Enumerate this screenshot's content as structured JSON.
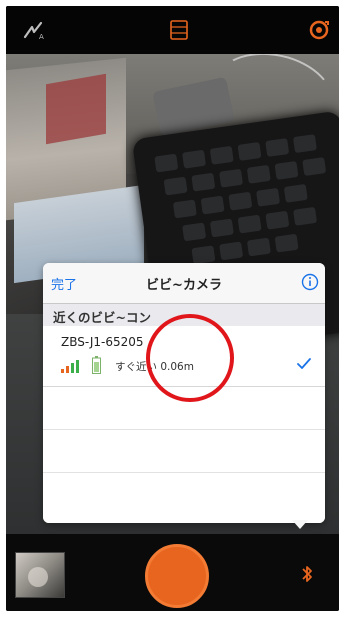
{
  "colors": {
    "accent_orange": "#e8651f",
    "link_blue": "#1a73e8",
    "annotation_red": "#e0161b"
  },
  "topbar": {
    "flash_icon": "flash-auto-icon",
    "grid_icon": "grid-icon",
    "switch_icon": "camera-switch-icon"
  },
  "popover": {
    "done_label": "完了",
    "title": "ビビ~カメラ",
    "info_icon": "info-icon",
    "section_header": "近くのビビ~コン",
    "device": {
      "name": "ZBS-J1-65205",
      "distance_text": "すぐ近い 0.06m",
      "selected": true
    }
  },
  "bottombar": {
    "shutter_icon": "shutter-button",
    "bluetooth_icon": "bluetooth-icon"
  }
}
